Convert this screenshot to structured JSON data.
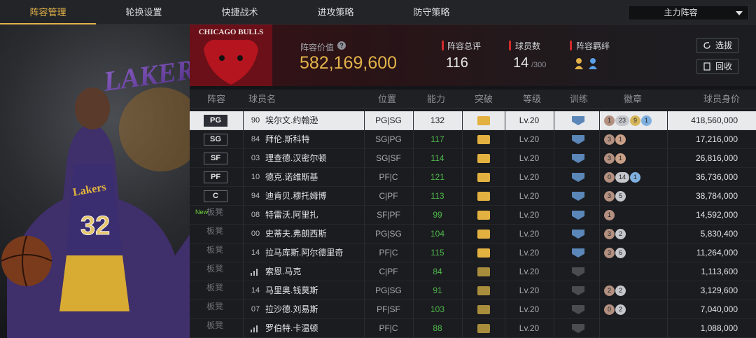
{
  "tabs": [
    "阵容管理",
    "轮换设置",
    "快捷战术",
    "进攻策略",
    "防守策略"
  ],
  "dropdown": {
    "value": "主力阵容"
  },
  "player_art": {
    "team_text": "LOS ANGELES LAKERS",
    "jersey_team": "Lakers",
    "jersey_number": "32"
  },
  "header": {
    "logo_text": "CHICAGO BULLS",
    "value_label": "阵容价值",
    "value": "582,169,600",
    "rating_label": "阵容总评",
    "rating": "116",
    "count_label": "球员数",
    "count": "14",
    "count_total": "/300",
    "bond_label": "阵容羁绊"
  },
  "buttons": {
    "pick": "选拔",
    "recycle": "回收"
  },
  "columns": [
    "阵容",
    "球员名",
    "位置",
    "能力",
    "突破",
    "等级",
    "训练",
    "徽章",
    "球员身价"
  ],
  "new_tag": "New",
  "rows": [
    {
      "slot": "PG",
      "num": "90",
      "name": "埃尔文.约翰逊",
      "pos": "PG|SG",
      "ability": "132",
      "level": "Lv.20",
      "badges": [
        "1",
        "23",
        "9",
        "1"
      ],
      "value": "418,560,000"
    },
    {
      "slot": "SG",
      "num": "84",
      "name": "拜伦.斯科特",
      "pos": "SG|PG",
      "ability": "117",
      "level": "Lv.20",
      "badges": [
        "3",
        "1"
      ],
      "value": "17,216,000"
    },
    {
      "slot": "SF",
      "num": "03",
      "name": "理查德.汉密尔顿",
      "pos": "SG|SF",
      "ability": "114",
      "level": "Lv.20",
      "badges": [
        "3",
        "1"
      ],
      "value": "26,816,000"
    },
    {
      "slot": "PF",
      "num": "10",
      "name": "德克.诺维斯基",
      "pos": "PF|C",
      "ability": "121",
      "level": "Lv.20",
      "badges": [
        "0",
        "14",
        "1"
      ],
      "value": "36,736,000"
    },
    {
      "slot": "C",
      "num": "94",
      "name": "迪肯贝.穆托姆博",
      "pos": "C|PF",
      "ability": "113",
      "level": "Lv.20",
      "badges": [
        "3",
        "5"
      ],
      "value": "38,784,000"
    },
    {
      "slot": "板凳",
      "num": "08",
      "name": "特雷沃.阿里扎",
      "pos": "SF|PF",
      "ability": "99",
      "level": "Lv.20",
      "badges": [
        "1"
      ],
      "value": "14,592,000"
    },
    {
      "slot": "板凳",
      "num": "00",
      "name": "史蒂夫.弗朗西斯",
      "pos": "PG|SG",
      "ability": "104",
      "level": "Lv.20",
      "badges": [
        "3",
        "2"
      ],
      "value": "5,830,400"
    },
    {
      "slot": "板凳",
      "num": "14",
      "name": "拉马库斯.阿尔德里奇",
      "pos": "PF|C",
      "ability": "115",
      "level": "Lv.20",
      "badges": [
        "3",
        "6"
      ],
      "value": "11,264,000"
    },
    {
      "slot": "板凳",
      "num": "",
      "name": "索恩.马克",
      "pos": "C|PF",
      "ability": "84",
      "level": "Lv.20",
      "badges": [],
      "value": "1,113,600"
    },
    {
      "slot": "板凳",
      "num": "14",
      "name": "马里奥.钱莫斯",
      "pos": "PG|SG",
      "ability": "91",
      "level": "Lv.20",
      "badges": [
        "2",
        "2"
      ],
      "value": "3,129,600"
    },
    {
      "slot": "板凳",
      "num": "07",
      "name": "拉沙德.刘易斯",
      "pos": "PF|SF",
      "ability": "103",
      "level": "Lv.20",
      "badges": [
        "0",
        "2"
      ],
      "value": "7,040,000"
    },
    {
      "slot": "板凳",
      "num": "",
      "name": "罗伯特.卡温顿",
      "pos": "PF|C",
      "ability": "88",
      "level": "Lv.20",
      "badges": [],
      "value": "1,088,000"
    }
  ],
  "colors": {
    "accent": "#e2b24a",
    "ability_green": "#4fb84a",
    "selected_row": "#e9eaec",
    "train_blue": "#5a86b8"
  }
}
